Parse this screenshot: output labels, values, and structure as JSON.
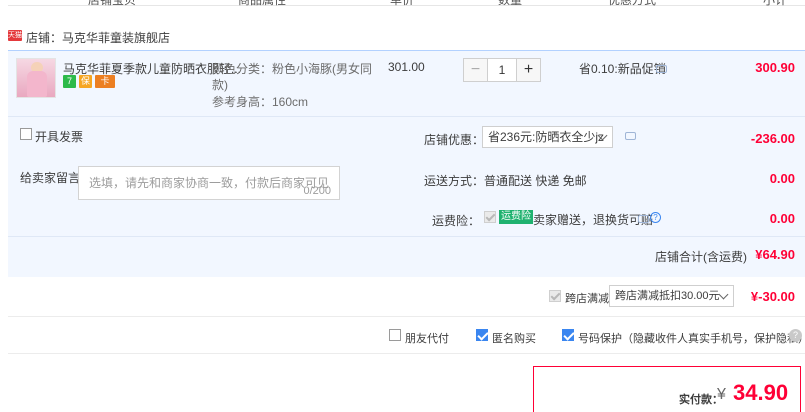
{
  "header_columns": [
    "店铺宝贝",
    "商品属性",
    "单价",
    "数量",
    "优惠方式",
    "小计"
  ],
  "shop": {
    "tag": "天猫",
    "label": "店铺：马克华菲童装旗舰店"
  },
  "item": {
    "title": "马克华菲夏季款儿童防晒衣服轻...",
    "badges": [
      "7",
      "保",
      "卡"
    ],
    "attr_line1": "颜色分类：粉色小海豚(男女同",
    "attr_line2": "款)",
    "attr_line3": "参考身高：160cm",
    "price": "301.00",
    "qty": "1",
    "minus": "−",
    "plus": "+",
    "promo": "省0.10:新品促销",
    "subtotal": "300.90"
  },
  "invoice": {
    "label": "开具发票"
  },
  "coupon": {
    "label": "店铺优惠：",
    "selected": "省236元:防晒衣全少jz",
    "amount": "-236.00"
  },
  "memo": {
    "label": "给卖家留言：",
    "placeholder": "选填，请先和商家协商一致，付款后商家可见",
    "count": "0/200"
  },
  "shipping": {
    "label": "运送方式：",
    "value": "普通配送 快递 免邮",
    "amount": "0.00"
  },
  "insurance": {
    "label": "运费险：",
    "tag": "运费险",
    "text": "卖家赠送，退换货可赔",
    "amount": "0.00"
  },
  "shop_total": {
    "label": "店铺合计(含运费)",
    "value": "¥64.90"
  },
  "cross_shop": {
    "label": "跨店满减",
    "selected": "跨店满减抵扣30.00元",
    "amount": "¥-30.00"
  },
  "options": [
    {
      "label": "朋友代付",
      "checked": false
    },
    {
      "label": "匿名购买",
      "checked": true
    },
    {
      "label": "号码保护（隐藏收件人真实手机号，保护隐私）",
      "checked": true
    }
  ],
  "pay": {
    "label": "实付款：",
    "yen": "¥",
    "value": "34.90"
  },
  "colors": {
    "accent": "#ff0036",
    "blue": "#3a86f0",
    "green": "#1fb26f"
  }
}
